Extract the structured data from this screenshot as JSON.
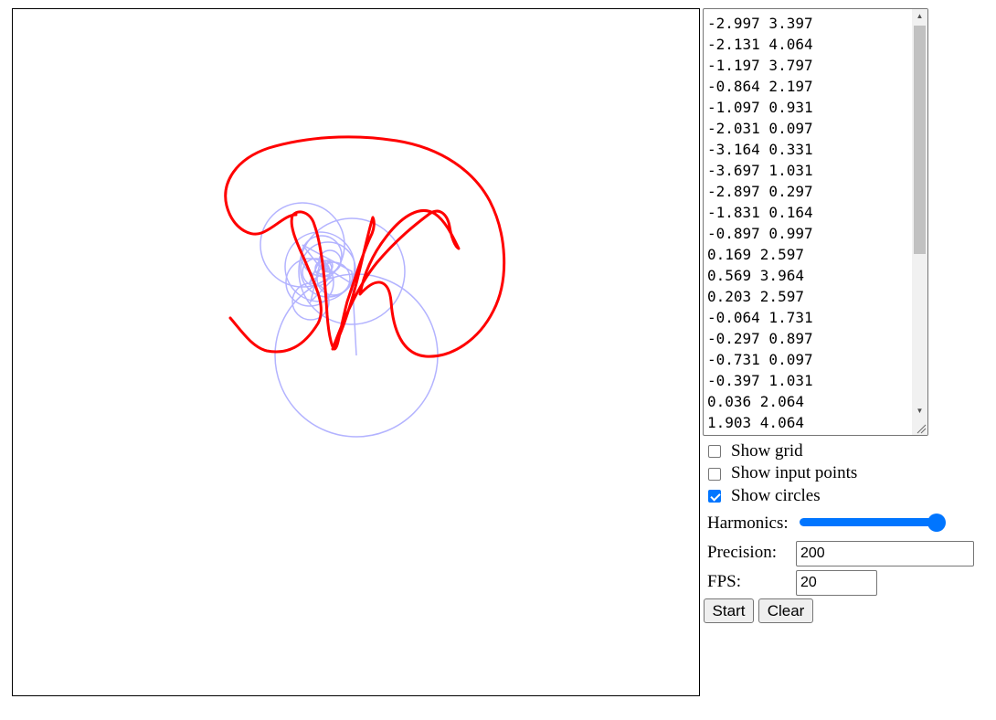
{
  "points_text": [
    "-2.997 3.397",
    "-2.131 4.064",
    "-1.197 3.797",
    "-0.864 2.197",
    "-1.097 0.931",
    "-2.031 0.097",
    "-3.164 0.331",
    "-3.697 1.031",
    "-2.897 0.297",
    "-1.831 0.164",
    "-0.897 0.997",
    "0.169 2.597",
    "0.569 3.964",
    "0.203 2.597",
    "-0.064 1.731",
    "-0.297 0.897",
    "-0.731 0.097",
    "-0.397 1.031",
    "0.036 2.064",
    "1.903 4.064"
  ],
  "controls": {
    "show_grid": {
      "label": "Show grid",
      "checked": false
    },
    "show_input_points": {
      "label": "Show input points",
      "checked": false
    },
    "show_circles": {
      "label": "Show circles",
      "checked": true
    },
    "harmonics": {
      "label": "Harmonics:",
      "value_fraction": 1.0
    },
    "precision": {
      "label": "Precision:",
      "value": "200"
    },
    "fps": {
      "label": "FPS:",
      "value": "20"
    },
    "start_label": "Start",
    "clear_label": "Clear"
  },
  "colors": {
    "curve": "#ff0000",
    "circles": "#b3b3ff",
    "accent": "#0075ff"
  },
  "icons": {
    "scroll_up": "triangle-up",
    "scroll_down": "triangle-down",
    "resize": "resize-grip"
  }
}
